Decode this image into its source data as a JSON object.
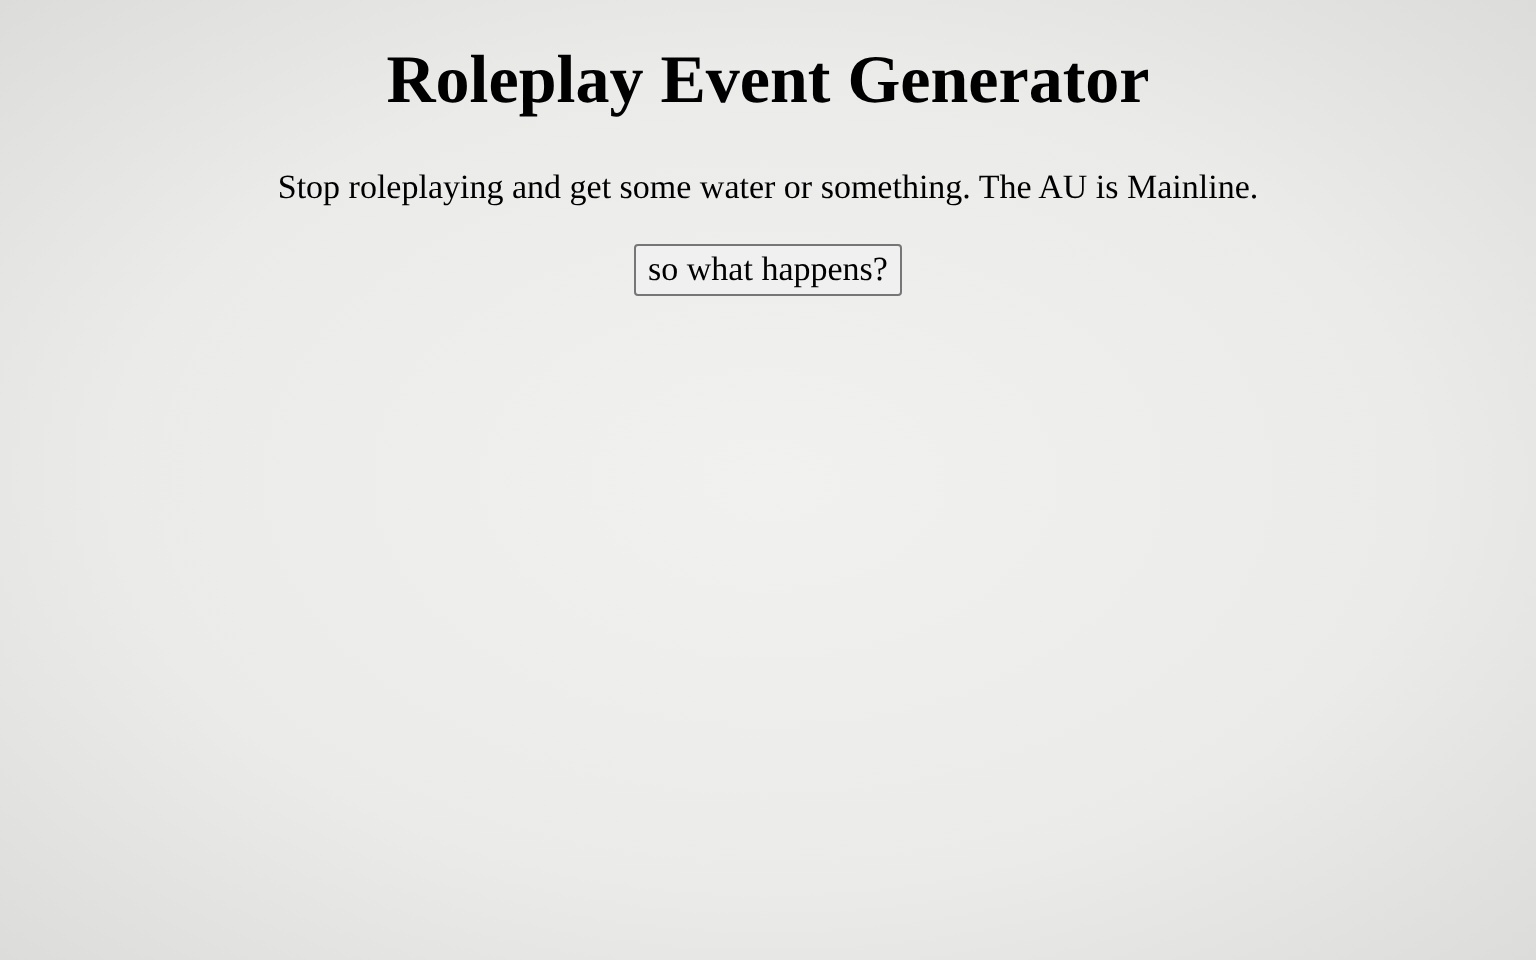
{
  "title": "Roleplay Event Generator",
  "message": "Stop roleplaying and get some water or something. The AU is Mainline.",
  "button": {
    "label": "so what happens?"
  }
}
